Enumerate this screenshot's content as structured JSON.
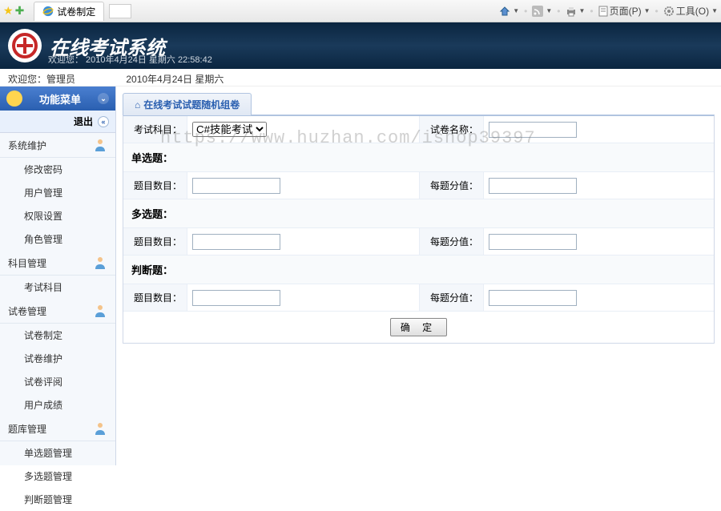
{
  "browser": {
    "tab_title": "试卷制定",
    "home_icon": "home",
    "rss_icon": "rss",
    "print_icon": "print",
    "page_label": "页面(P)",
    "tools_label": "工具(O)"
  },
  "banner": {
    "title": "在线考试系统",
    "welcome": "欢迎您：  2010年4月24日 星期六   22:58:42"
  },
  "info": {
    "welcome": "欢迎您：管理员",
    "date": "2010年4月24日 星期六"
  },
  "sidebar": {
    "menu_title": "功能菜单",
    "logout": "退出",
    "sections": [
      {
        "title": "系统维护",
        "items": [
          "修改密码",
          "用户管理",
          "权限设置",
          "角色管理"
        ]
      },
      {
        "title": "科目管理",
        "items": [
          "考试科目"
        ]
      },
      {
        "title": "试卷管理",
        "items": [
          "试卷制定",
          "试卷维护",
          "试卷评阅",
          "用户成绩"
        ]
      },
      {
        "title": "题库管理",
        "items": [
          "单选题管理",
          "多选题管理",
          "判断题管理"
        ]
      }
    ]
  },
  "panel": {
    "title": "在线考试试题随机组卷",
    "subject_label": "考试科目：",
    "subject_value": "C#技能考试",
    "paper_name_label": "试卷名称：",
    "sections": {
      "single": {
        "title": "单选题：",
        "count_label": "题目数目：",
        "score_label": "每题分值："
      },
      "multi": {
        "title": "多选题：",
        "count_label": "题目数目：",
        "score_label": "每题分值："
      },
      "judge": {
        "title": "判断题：",
        "count_label": "题目数目：",
        "score_label": "每题分值："
      }
    },
    "submit": "确 定"
  },
  "watermark": "https://www.huzhan.com/ishop39397"
}
